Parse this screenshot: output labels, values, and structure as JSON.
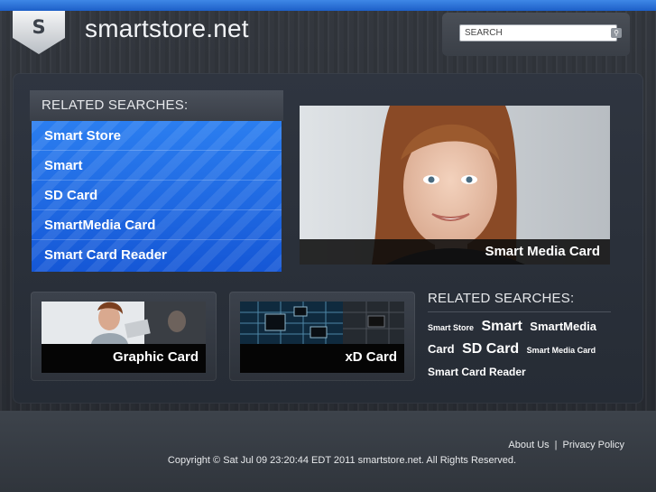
{
  "header": {
    "logo_letter": "S",
    "site_title": "smartstore.net",
    "search_placeholder": "SEARCH"
  },
  "related_searches": {
    "heading": "RELATED SEARCHES:",
    "items": [
      {
        "label": "Smart Store"
      },
      {
        "label": "Smart"
      },
      {
        "label": "SD Card"
      },
      {
        "label": "SmartMedia Card"
      },
      {
        "label": "Smart Card Reader"
      }
    ]
  },
  "hero": {
    "caption": "Smart Media Card"
  },
  "thumbnails": [
    {
      "label": "Graphic Card"
    },
    {
      "label": "xD Card"
    }
  ],
  "tag_cloud": {
    "heading": "RELATED SEARCHES:",
    "tags": [
      {
        "label": "Smart Store"
      },
      {
        "label": "Smart"
      },
      {
        "label": "SmartMedia Card"
      },
      {
        "label": "SD Card"
      },
      {
        "label": "Smart Media Card"
      },
      {
        "label": "Smart Card Reader"
      }
    ]
  },
  "footer": {
    "about_label": "About Us",
    "separator": "|",
    "privacy_label": "Privacy Policy",
    "copyright": "Copyright © Sat Jul 09 23:20:44 EDT 2011 smartstore.net. All Rights Reserved."
  },
  "colors": {
    "accent_blue": "#1d5fc8",
    "list_blue": "#2b7ef0",
    "background": "#2c3037"
  }
}
